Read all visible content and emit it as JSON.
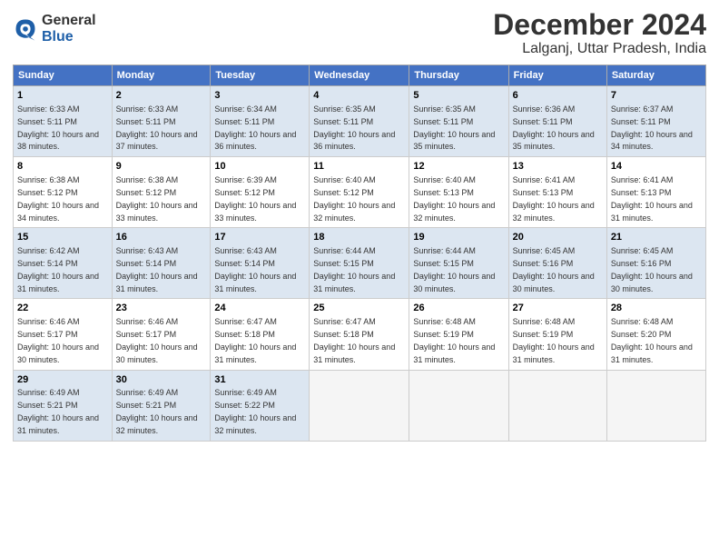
{
  "logo": {
    "text_line1": "General",
    "text_line2": "Blue"
  },
  "title": {
    "month": "December 2024",
    "location": "Lalganj, Uttar Pradesh, India"
  },
  "headers": [
    "Sunday",
    "Monday",
    "Tuesday",
    "Wednesday",
    "Thursday",
    "Friday",
    "Saturday"
  ],
  "weeks": [
    [
      {
        "day": "1",
        "sunrise": "6:33 AM",
        "sunset": "5:11 PM",
        "daylight": "10 hours and 38 minutes."
      },
      {
        "day": "2",
        "sunrise": "6:33 AM",
        "sunset": "5:11 PM",
        "daylight": "10 hours and 37 minutes."
      },
      {
        "day": "3",
        "sunrise": "6:34 AM",
        "sunset": "5:11 PM",
        "daylight": "10 hours and 36 minutes."
      },
      {
        "day": "4",
        "sunrise": "6:35 AM",
        "sunset": "5:11 PM",
        "daylight": "10 hours and 36 minutes."
      },
      {
        "day": "5",
        "sunrise": "6:35 AM",
        "sunset": "5:11 PM",
        "daylight": "10 hours and 35 minutes."
      },
      {
        "day": "6",
        "sunrise": "6:36 AM",
        "sunset": "5:11 PM",
        "daylight": "10 hours and 35 minutes."
      },
      {
        "day": "7",
        "sunrise": "6:37 AM",
        "sunset": "5:11 PM",
        "daylight": "10 hours and 34 minutes."
      }
    ],
    [
      {
        "day": "8",
        "sunrise": "6:38 AM",
        "sunset": "5:12 PM",
        "daylight": "10 hours and 34 minutes."
      },
      {
        "day": "9",
        "sunrise": "6:38 AM",
        "sunset": "5:12 PM",
        "daylight": "10 hours and 33 minutes."
      },
      {
        "day": "10",
        "sunrise": "6:39 AM",
        "sunset": "5:12 PM",
        "daylight": "10 hours and 33 minutes."
      },
      {
        "day": "11",
        "sunrise": "6:40 AM",
        "sunset": "5:12 PM",
        "daylight": "10 hours and 32 minutes."
      },
      {
        "day": "12",
        "sunrise": "6:40 AM",
        "sunset": "5:13 PM",
        "daylight": "10 hours and 32 minutes."
      },
      {
        "day": "13",
        "sunrise": "6:41 AM",
        "sunset": "5:13 PM",
        "daylight": "10 hours and 32 minutes."
      },
      {
        "day": "14",
        "sunrise": "6:41 AM",
        "sunset": "5:13 PM",
        "daylight": "10 hours and 31 minutes."
      }
    ],
    [
      {
        "day": "15",
        "sunrise": "6:42 AM",
        "sunset": "5:14 PM",
        "daylight": "10 hours and 31 minutes."
      },
      {
        "day": "16",
        "sunrise": "6:43 AM",
        "sunset": "5:14 PM",
        "daylight": "10 hours and 31 minutes."
      },
      {
        "day": "17",
        "sunrise": "6:43 AM",
        "sunset": "5:14 PM",
        "daylight": "10 hours and 31 minutes."
      },
      {
        "day": "18",
        "sunrise": "6:44 AM",
        "sunset": "5:15 PM",
        "daylight": "10 hours and 31 minutes."
      },
      {
        "day": "19",
        "sunrise": "6:44 AM",
        "sunset": "5:15 PM",
        "daylight": "10 hours and 30 minutes."
      },
      {
        "day": "20",
        "sunrise": "6:45 AM",
        "sunset": "5:16 PM",
        "daylight": "10 hours and 30 minutes."
      },
      {
        "day": "21",
        "sunrise": "6:45 AM",
        "sunset": "5:16 PM",
        "daylight": "10 hours and 30 minutes."
      }
    ],
    [
      {
        "day": "22",
        "sunrise": "6:46 AM",
        "sunset": "5:17 PM",
        "daylight": "10 hours and 30 minutes."
      },
      {
        "day": "23",
        "sunrise": "6:46 AM",
        "sunset": "5:17 PM",
        "daylight": "10 hours and 30 minutes."
      },
      {
        "day": "24",
        "sunrise": "6:47 AM",
        "sunset": "5:18 PM",
        "daylight": "10 hours and 31 minutes."
      },
      {
        "day": "25",
        "sunrise": "6:47 AM",
        "sunset": "5:18 PM",
        "daylight": "10 hours and 31 minutes."
      },
      {
        "day": "26",
        "sunrise": "6:48 AM",
        "sunset": "5:19 PM",
        "daylight": "10 hours and 31 minutes."
      },
      {
        "day": "27",
        "sunrise": "6:48 AM",
        "sunset": "5:19 PM",
        "daylight": "10 hours and 31 minutes."
      },
      {
        "day": "28",
        "sunrise": "6:48 AM",
        "sunset": "5:20 PM",
        "daylight": "10 hours and 31 minutes."
      }
    ],
    [
      {
        "day": "29",
        "sunrise": "6:49 AM",
        "sunset": "5:21 PM",
        "daylight": "10 hours and 31 minutes."
      },
      {
        "day": "30",
        "sunrise": "6:49 AM",
        "sunset": "5:21 PM",
        "daylight": "10 hours and 32 minutes."
      },
      {
        "day": "31",
        "sunrise": "6:49 AM",
        "sunset": "5:22 PM",
        "daylight": "10 hours and 32 minutes."
      },
      null,
      null,
      null,
      null
    ]
  ]
}
